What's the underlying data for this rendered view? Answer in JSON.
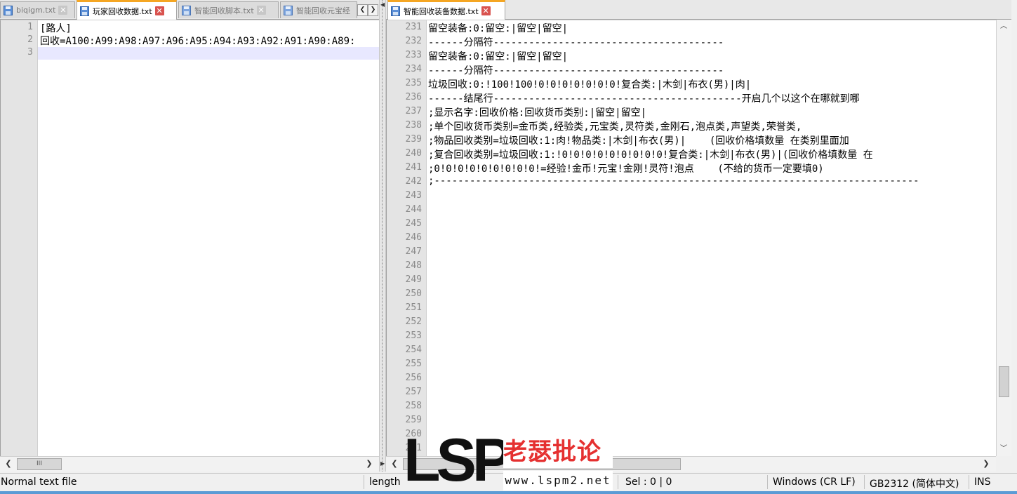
{
  "left": {
    "tabs": [
      {
        "label": "biqigm.txt",
        "active": false
      },
      {
        "label": "玩家回收数据.txt",
        "active": true
      },
      {
        "label": "智能回收脚本.txt",
        "active": false
      },
      {
        "label": "智能回收元宝经",
        "active": false
      }
    ],
    "line_numbers": [
      "1",
      "2",
      "3"
    ],
    "lines": [
      "[路人]",
      "回收=A100:A99:A98:A97:A96:A95:A94:A93:A92:A91:A90:A89:",
      ""
    ],
    "hscroll_thumb_label": "III"
  },
  "right": {
    "tabs": [
      {
        "label": "智能回收装备数据.txt",
        "active": true
      }
    ],
    "line_numbers": [
      "231",
      "232",
      "233",
      "234",
      "235",
      "236",
      "237",
      "238",
      "239",
      "240",
      "241",
      "242",
      "243",
      "244",
      "245",
      "246",
      "247",
      "248",
      "249",
      "250",
      "251",
      "252",
      "253",
      "254",
      "255",
      "256",
      "257",
      "258",
      "259",
      "260",
      "261"
    ],
    "lines": [
      "留空装备:0:留空:|留空|留空|",
      "------分隔符---------------------------------------",
      "留空装备:0:留空:|留空|留空|",
      "------分隔符---------------------------------------",
      "垃圾回收:0:!100!100!0!0!0!0!0!0!0!复合类:|木剑|布衣(男)|肉|",
      "------结尾行------------------------------------------开启几个以这个在哪就到哪",
      ";显示名字:回收价格:回收货币类别:|留空|留空|",
      ";单个回收货币类别=金币类,经验类,元宝类,灵符类,金刚石,泡点类,声望类,荣誉类,",
      ";物品回收类别=垃圾回收:1:肉!物品类:|木剑|布衣(男)|    (回收价格填数量 在类别里面加",
      ";复合回收类别=垃圾回收:1:!0!0!0!0!0!0!0!0!0!复合类:|木剑|布衣(男)|(回收价格填数量 在",
      ";0!0!0!0!0!0!0!0!0!=经验!金币!元宝!金刚!灵符!泡点    (不给的货币一定要填0)",
      ";----------------------------------------------------------------------------------"
    ]
  },
  "status": {
    "file_type": "Normal text file",
    "length": "length",
    "sel": "Sel : 0 | 0",
    "eol": "Windows (CR LF)",
    "encoding": "GB2312 (简体中文)",
    "mode": "INS"
  },
  "watermark": {
    "logo": "LSP",
    "name": "老瑟批论坛",
    "url": "www.lspm2.net"
  },
  "icons": {
    "file": "file-save-icon",
    "close": "close-tab-icon",
    "left": "scroll-left-icon",
    "right": "scroll-right-icon",
    "up": "scroll-up-icon",
    "down": "scroll-down-icon"
  },
  "colors": {
    "active_tab_accent": "#f5a623",
    "close_active": "#d9534f",
    "current_line": "#e8e8ff",
    "watermark_red": "#e53030"
  }
}
